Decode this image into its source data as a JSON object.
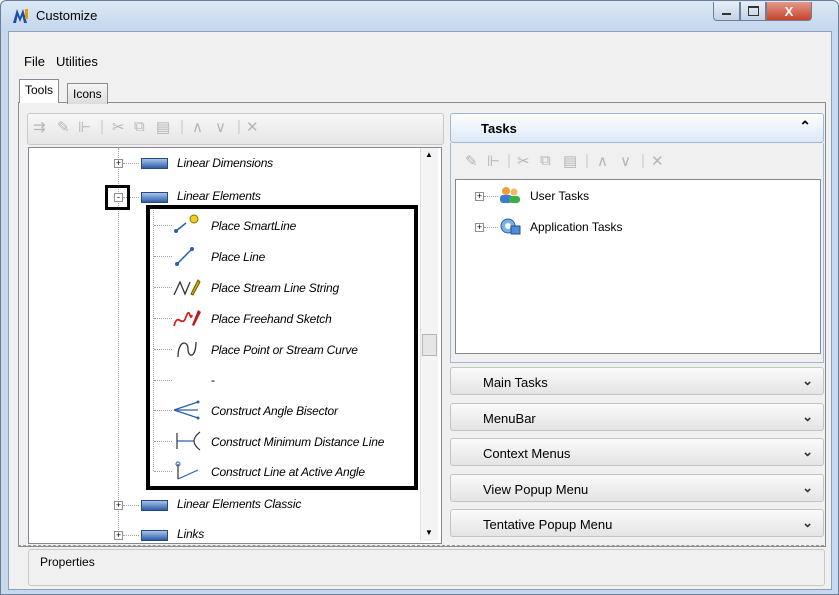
{
  "window": {
    "title": "Customize",
    "close_label": "X"
  },
  "menubar": {
    "items": [
      "File",
      "Utilities"
    ]
  },
  "tabs": [
    "Tools",
    "Icons"
  ],
  "tree": {
    "items": [
      {
        "label": "Linear Dimensions",
        "expander": "+"
      },
      {
        "label": "Linear Elements",
        "expander": "-"
      },
      {
        "label": "Place SmartLine"
      },
      {
        "label": "Place Line"
      },
      {
        "label": "Place Stream Line String"
      },
      {
        "label": "Place Freehand Sketch"
      },
      {
        "label": "Place Point or Stream Curve"
      },
      {
        "label": "-"
      },
      {
        "label": "Construct Angle Bisector"
      },
      {
        "label": "Construct Minimum Distance Line"
      },
      {
        "label": "Construct Line at Active Angle"
      },
      {
        "label": "Linear Elements Classic",
        "expander": "+"
      },
      {
        "label": "Links",
        "expander": "+"
      }
    ]
  },
  "tasks": {
    "title": "Tasks",
    "collapse_icon": "chevron-up-icon",
    "items": [
      "User Tasks",
      "Application Tasks"
    ]
  },
  "accordion": [
    "Main Tasks",
    "MenuBar",
    "Context Menus",
    "View Popup Menu",
    "Tentative Popup Menu"
  ],
  "properties": {
    "label": "Properties"
  },
  "colors": {
    "accent_blue": "#2e5ea8",
    "close_red": "#c5442b",
    "tasks_header": "#dbe9f7"
  }
}
